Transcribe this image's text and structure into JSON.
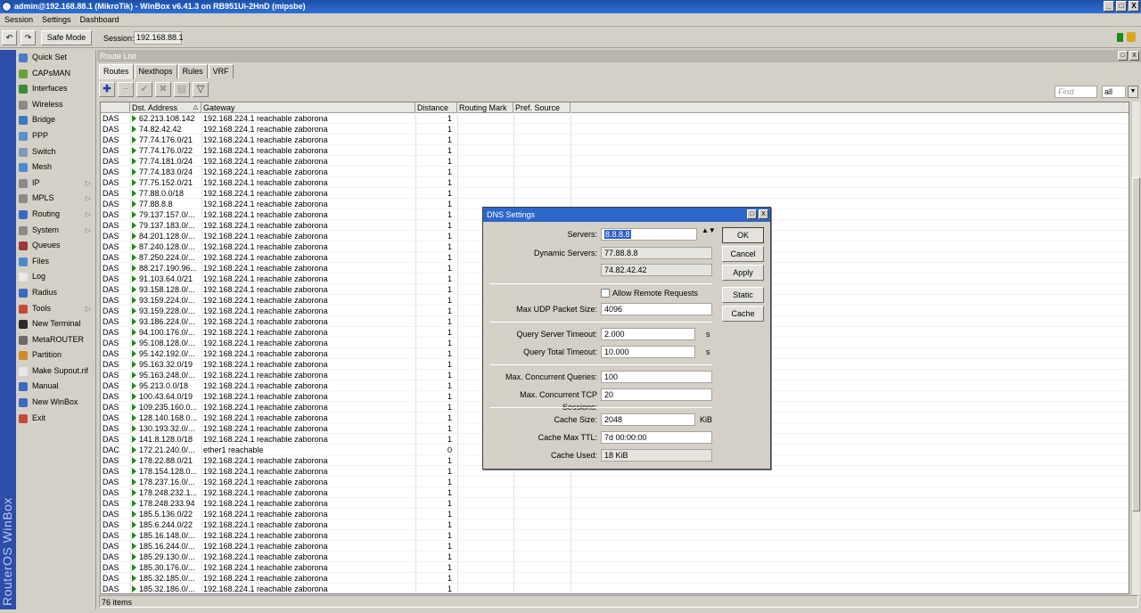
{
  "window": {
    "title": "admin@192.168.88.1 (MikroTik) - WinBox v6.41.3 on RB951Ui-2HnD (mipsbe)",
    "minimize": "_",
    "maximize": "□",
    "close": "X"
  },
  "menu": [
    "Session",
    "Settings",
    "Dashboard"
  ],
  "toolbar": {
    "undo": "↶",
    "redo": "↷",
    "safe_mode": "Safe Mode",
    "session_label": "Session:",
    "session_value": "192.168.88.1"
  },
  "sidebar": {
    "vertical_label": "RouterOS WinBox",
    "items": [
      {
        "label": "Quick Set",
        "icon": "quickset-icon",
        "color": "#4a7cc4"
      },
      {
        "label": "CAPsMAN",
        "icon": "capsman-icon",
        "color": "#6a9f3a"
      },
      {
        "label": "Interfaces",
        "icon": "interfaces-icon",
        "color": "#3a8a3a"
      },
      {
        "label": "Wireless",
        "icon": "wireless-icon",
        "color": "#8a8a8a"
      },
      {
        "label": "Bridge",
        "icon": "bridge-icon",
        "color": "#3a78c4"
      },
      {
        "label": "PPP",
        "icon": "ppp-icon",
        "color": "#5a8fd0"
      },
      {
        "label": "Switch",
        "icon": "switch-icon",
        "color": "#7a9ab8"
      },
      {
        "label": "Mesh",
        "icon": "mesh-icon",
        "color": "#4a8ad0"
      },
      {
        "label": "IP",
        "icon": "ip-icon",
        "color": "#8a8a8a",
        "submenu": true
      },
      {
        "label": "MPLS",
        "icon": "mpls-icon",
        "color": "#8a8a8a",
        "submenu": true
      },
      {
        "label": "Routing",
        "icon": "routing-icon",
        "color": "#3a6ac4",
        "submenu": true
      },
      {
        "label": "System",
        "icon": "system-icon",
        "color": "#8a8a8a",
        "submenu": true
      },
      {
        "label": "Queues",
        "icon": "queues-icon",
        "color": "#9a3a3a"
      },
      {
        "label": "Files",
        "icon": "files-icon",
        "color": "#4a8ad0"
      },
      {
        "label": "Log",
        "icon": "log-icon",
        "color": "#e8e8e8"
      },
      {
        "label": "Radius",
        "icon": "radius-icon",
        "color": "#3a6ac4"
      },
      {
        "label": "Tools",
        "icon": "tools-icon",
        "color": "#c44a3a",
        "submenu": true
      },
      {
        "label": "New Terminal",
        "icon": "terminal-icon",
        "color": "#2a2a2a"
      },
      {
        "label": "MetaROUTER",
        "icon": "metarouter-icon",
        "color": "#6a6a6a"
      },
      {
        "label": "Partition",
        "icon": "partition-icon",
        "color": "#d08a2a"
      },
      {
        "label": "Make Supout.rif",
        "icon": "supout-icon",
        "color": "#e8e8e8"
      },
      {
        "label": "Manual",
        "icon": "manual-icon",
        "color": "#3a6ac4"
      },
      {
        "label": "New WinBox",
        "icon": "winbox-icon",
        "color": "#3a6ac4"
      },
      {
        "label": "Exit",
        "icon": "exit-icon",
        "color": "#c44a3a"
      }
    ]
  },
  "route_list": {
    "title": "Route List",
    "tabs": [
      "Routes",
      "Nexthops",
      "Rules",
      "VRF"
    ],
    "tool_icons": [
      "✚",
      "−",
      "✔",
      "✖",
      "▤",
      "▽"
    ],
    "find_placeholder": "Find",
    "filter_value": "all",
    "filter_arrow": "▼",
    "columns": {
      "flag": "",
      "dst": "Dst. Address",
      "sort_glyph": "△",
      "gateway": "Gateway",
      "distance": "Distance",
      "routing_mark": "Routing Mark",
      "pref_source": "Pref. Source"
    },
    "rows": [
      [
        "DAS",
        "62.213.108.142",
        "192.168.224.1 reachable zaborona",
        "1"
      ],
      [
        "DAS",
        "74.82.42.42",
        "192.168.224.1 reachable zaborona",
        "1"
      ],
      [
        "DAS",
        "77.74.176.0/21",
        "192.168.224.1 reachable zaborona",
        "1"
      ],
      [
        "DAS",
        "77.74.176.0/22",
        "192.168.224.1 reachable zaborona",
        "1"
      ],
      [
        "DAS",
        "77.74.181.0/24",
        "192.168.224.1 reachable zaborona",
        "1"
      ],
      [
        "DAS",
        "77.74.183.0/24",
        "192.168.224.1 reachable zaborona",
        "1"
      ],
      [
        "DAS",
        "77.75.152.0/21",
        "192.168.224.1 reachable zaborona",
        "1"
      ],
      [
        "DAS",
        "77.88.0.0/18",
        "192.168.224.1 reachable zaborona",
        "1"
      ],
      [
        "DAS",
        "77.88.8.8",
        "192.168.224.1 reachable zaborona",
        "1"
      ],
      [
        "DAS",
        "79.137.157.0/...",
        "192.168.224.1 reachable zaborona",
        "1"
      ],
      [
        "DAS",
        "79.137.183.0/...",
        "192.168.224.1 reachable zaborona",
        "1"
      ],
      [
        "DAS",
        "84.201.128.0/...",
        "192.168.224.1 reachable zaborona",
        "1"
      ],
      [
        "DAS",
        "87.240.128.0/...",
        "192.168.224.1 reachable zaborona",
        "1"
      ],
      [
        "DAS",
        "87.250.224.0/...",
        "192.168.224.1 reachable zaborona",
        "1"
      ],
      [
        "DAS",
        "88.217.190.96...",
        "192.168.224.1 reachable zaborona",
        "1"
      ],
      [
        "DAS",
        "91.103.64.0/21",
        "192.168.224.1 reachable zaborona",
        "1"
      ],
      [
        "DAS",
        "93.158.128.0/...",
        "192.168.224.1 reachable zaborona",
        "1"
      ],
      [
        "DAS",
        "93.159.224.0/...",
        "192.168.224.1 reachable zaborona",
        "1"
      ],
      [
        "DAS",
        "93.159.228.0/...",
        "192.168.224.1 reachable zaborona",
        "1"
      ],
      [
        "DAS",
        "93.186.224.0/...",
        "192.168.224.1 reachable zaborona",
        "1"
      ],
      [
        "DAS",
        "94.100.176.0/...",
        "192.168.224.1 reachable zaborona",
        "1"
      ],
      [
        "DAS",
        "95.108.128.0/...",
        "192.168.224.1 reachable zaborona",
        "1"
      ],
      [
        "DAS",
        "95.142.192.0/...",
        "192.168.224.1 reachable zaborona",
        "1"
      ],
      [
        "DAS",
        "95.163.32.0/19",
        "192.168.224.1 reachable zaborona",
        "1"
      ],
      [
        "DAS",
        "95.163.248.0/...",
        "192.168.224.1 reachable zaborona",
        "1"
      ],
      [
        "DAS",
        "95.213.0.0/18",
        "192.168.224.1 reachable zaborona",
        "1"
      ],
      [
        "DAS",
        "100.43.64.0/19",
        "192.168.224.1 reachable zaborona",
        "1"
      ],
      [
        "DAS",
        "109.235.160.0...",
        "192.168.224.1 reachable zaborona",
        "1"
      ],
      [
        "DAS",
        "128.140.168.0...",
        "192.168.224.1 reachable zaborona",
        "1"
      ],
      [
        "DAS",
        "130.193.32.0/...",
        "192.168.224.1 reachable zaborona",
        "1"
      ],
      [
        "DAS",
        "141.8.128.0/18",
        "192.168.224.1 reachable zaborona",
        "1"
      ],
      [
        "DAC",
        "172.21.240.0/...",
        "ether1 reachable",
        "0"
      ],
      [
        "DAS",
        "178.22.88.0/21",
        "192.168.224.1 reachable zaborona",
        "1"
      ],
      [
        "DAS",
        "178.154.128.0...",
        "192.168.224.1 reachable zaborona",
        "1"
      ],
      [
        "DAS",
        "178.237.16.0/...",
        "192.168.224.1 reachable zaborona",
        "1"
      ],
      [
        "DAS",
        "178.248.232.1...",
        "192.168.224.1 reachable zaborona",
        "1"
      ],
      [
        "DAS",
        "178.248.233.94",
        "192.168.224.1 reachable zaborona",
        "1"
      ],
      [
        "DAS",
        "185.5.136.0/22",
        "192.168.224.1 reachable zaborona",
        "1"
      ],
      [
        "DAS",
        "185.6.244.0/22",
        "192.168.224.1 reachable zaborona",
        "1"
      ],
      [
        "DAS",
        "185.16.148.0/...",
        "192.168.224.1 reachable zaborona",
        "1"
      ],
      [
        "DAS",
        "185.16.244.0/...",
        "192.168.224.1 reachable zaborona",
        "1"
      ],
      [
        "DAS",
        "185.29.130.0/...",
        "192.168.224.1 reachable zaborona",
        "1"
      ],
      [
        "DAS",
        "185.30.176.0/...",
        "192.168.224.1 reachable zaborona",
        "1"
      ],
      [
        "DAS",
        "185.32.185.0/...",
        "192.168.224.1 reachable zaborona",
        "1"
      ],
      [
        "DAS",
        "185.32.186.0/...",
        "192.168.224.1 reachable zaborona",
        "1"
      ]
    ],
    "status": "76 items"
  },
  "dns_dialog": {
    "title": "DNS Settings",
    "servers_label": "Servers:",
    "servers_value": "8.8.8.8",
    "servers_arrows": "▲▼",
    "dynamic_servers_label": "Dynamic Servers:",
    "dynamic_servers": [
      "77.88.8.8",
      "74.82.42.42"
    ],
    "allow_remote_label": "Allow Remote Requests",
    "max_udp_label": "Max UDP Packet Size:",
    "max_udp_value": "4096",
    "query_server_timeout_label": "Query Server Timeout:",
    "query_server_timeout_value": "2.000",
    "query_total_timeout_label": "Query Total Timeout:",
    "query_total_timeout_value": "10.000",
    "unit_s": "s",
    "max_concurrent_queries_label": "Max. Concurrent Queries:",
    "max_concurrent_queries_value": "100",
    "max_concurrent_tcp_label": "Max. Concurrent TCP Sessions:",
    "max_concurrent_tcp_value": "20",
    "cache_size_label": "Cache Size:",
    "cache_size_value": "2048",
    "cache_size_unit": "KiB",
    "cache_max_ttl_label": "Cache Max TTL:",
    "cache_max_ttl_value": "7d 00:00:00",
    "cache_used_label": "Cache Used:",
    "cache_used_value": "18 KiB",
    "buttons": {
      "ok": "OK",
      "cancel": "Cancel",
      "apply": "Apply",
      "static": "Static",
      "cache": "Cache"
    }
  }
}
